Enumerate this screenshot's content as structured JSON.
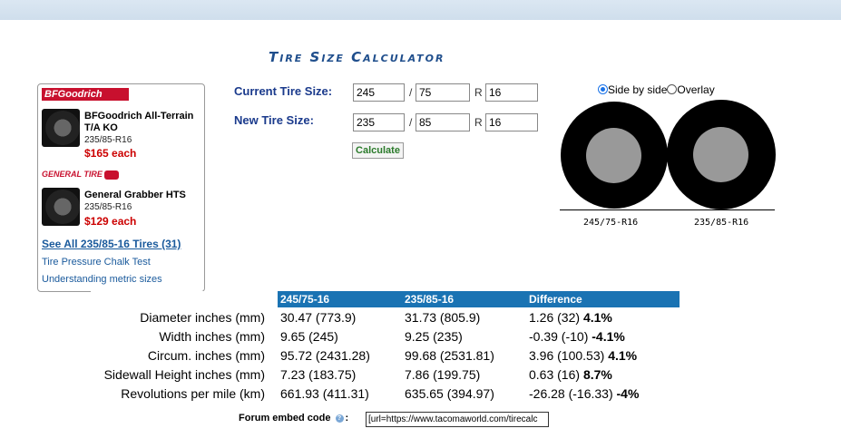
{
  "title": "Tire Size Calculator",
  "ads": {
    "brand1_logo": "BFGoodrich",
    "tire1": {
      "name": "BFGoodrich All-Terrain T/A KO",
      "size": "235/85-R16",
      "price": "$165 each"
    },
    "brand2_logo": "GENERAL TIRE",
    "tire2": {
      "name": "General Grabber HTS",
      "size": "235/85-R16",
      "price": "$129 each"
    },
    "see_all_link": "See All 235/85-16 Tires (31)",
    "links": [
      "Tire Pressure Chalk Test",
      "Understanding metric sizes"
    ]
  },
  "form": {
    "current_label": "Current Tire Size:",
    "new_label": "New Tire Size:",
    "current": {
      "width": "245",
      "ratio": "75",
      "rim": "16"
    },
    "new": {
      "width": "235",
      "ratio": "85",
      "rim": "16"
    },
    "slash": "/",
    "r": "R",
    "calculate_label": "Calculate"
  },
  "view": {
    "side_by_side_label": "Side by side",
    "overlay_label": "Overlay",
    "selected": "side_by_side",
    "tire1_caption": "245/75-R16",
    "tire2_caption": "235/85-R16"
  },
  "table": {
    "headers": [
      "",
      "245/75-16",
      "235/85-16",
      "Difference"
    ],
    "rows": [
      {
        "label": "Diameter inches (mm)",
        "a": "30.47 (773.9)",
        "b": "31.73 (805.9)",
        "diff": "1.26 (32)",
        "pct": "4.1%"
      },
      {
        "label": "Width inches (mm)",
        "a": "9.65 (245)",
        "b": "9.25 (235)",
        "diff": "-0.39 (-10)",
        "pct": "-4.1%"
      },
      {
        "label": "Circum. inches (mm)",
        "a": "95.72 (2431.28)",
        "b": "99.68 (2531.81)",
        "diff": "3.96 (100.53)",
        "pct": "4.1%"
      },
      {
        "label": "Sidewall Height inches (mm)",
        "a": "7.23 (183.75)",
        "b": "7.86 (199.75)",
        "diff": "0.63 (16)",
        "pct": "8.7%"
      },
      {
        "label": "Revolutions per mile (km)",
        "a": "661.93 (411.31)",
        "b": "635.65 (394.97)",
        "diff": "-26.28 (-16.33)",
        "pct": "-4%"
      }
    ]
  },
  "embed": {
    "label": "Forum embed code",
    "help": "?",
    "colon": ":",
    "value": "[url=https://www.tacomaworld.com/tirecalc"
  }
}
